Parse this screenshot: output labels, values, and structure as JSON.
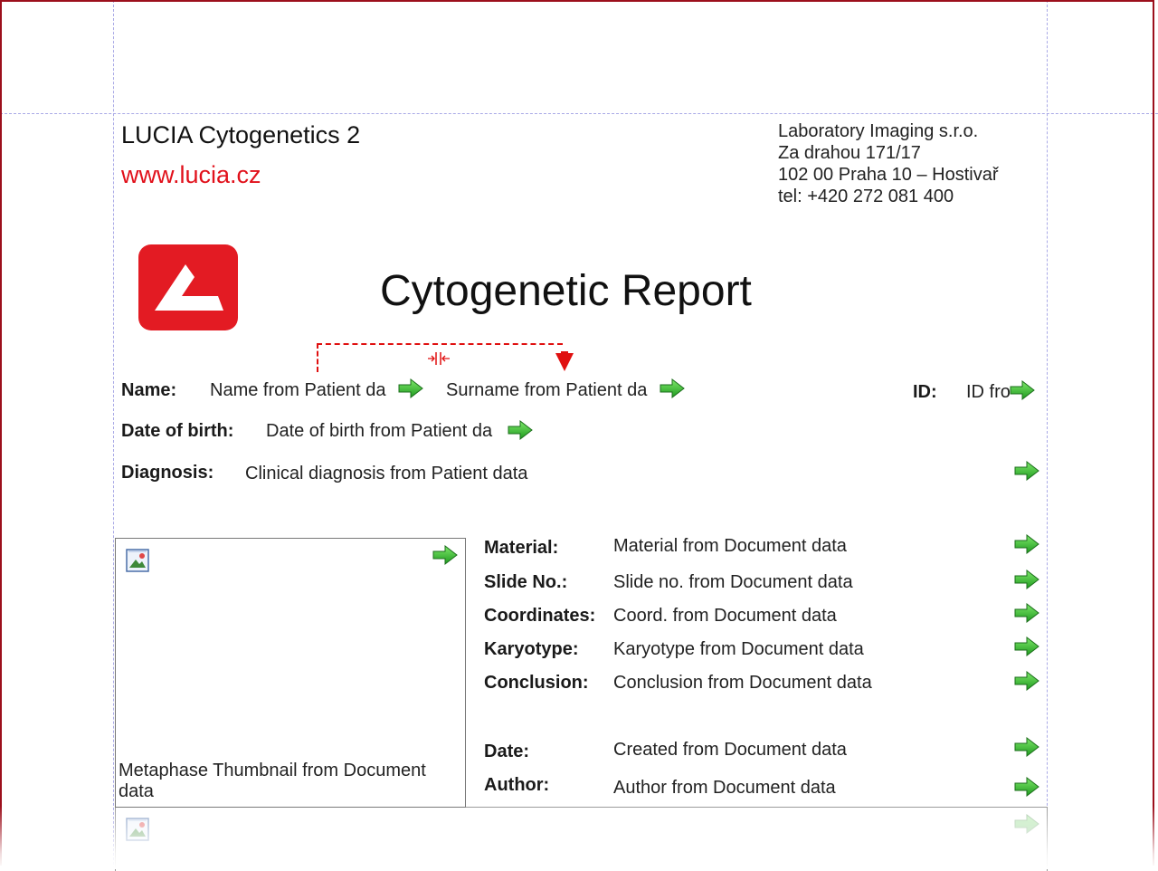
{
  "header": {
    "app_name": "LUCIA Cytogenetics 2",
    "website": "www.lucia.cz",
    "company_lines": [
      "Laboratory Imaging s.r.o.",
      "Za drahou 171/17",
      "102 00 Praha 10 – Hostivař",
      "tel: +420 272 081 400"
    ]
  },
  "logo": {
    "icon": "lucia-logo-icon",
    "color": "#e31b23"
  },
  "report_title": "Cytogenetic Report",
  "patient": {
    "name_label": "Name:",
    "name_value": "Name from Patient da",
    "surname_value": "Surname from Patient da",
    "id_label": "ID:",
    "id_value": "ID fro",
    "dob_label": "Date of birth:",
    "dob_value": "Date of birth from Patient da",
    "diagnosis_label": "Diagnosis:",
    "diagnosis_value": "Clinical diagnosis from Patient data"
  },
  "document": {
    "thumbnail_caption": "Metaphase Thumbnail from Document data",
    "fields": [
      {
        "label": "Material:",
        "value": "Material from Document data"
      },
      {
        "label": "Slide No.:",
        "value": "Slide no. from Document data"
      },
      {
        "label": "Coordinates:",
        "value": "Coord. from Document data"
      },
      {
        "label": "Karyotype:",
        "value": "Karyotype from Document data"
      },
      {
        "label": "Conclusion:",
        "value": "Conclusion from Document data"
      },
      {
        "label": "Date:",
        "value": "Created from Document data"
      },
      {
        "label": "Author:",
        "value": "Author from Document data"
      }
    ]
  },
  "icons": {
    "bind_arrow": "green-arrow-icon",
    "image_placeholder": "image-placeholder-icon",
    "link_pin": "red-pin-icon",
    "split_handle": "split-handle-icon"
  },
  "colors": {
    "accent_red": "#e1111b",
    "arrow_green": "#2fb52f",
    "guide_blue": "#a9a9e6",
    "frame": "#9c0f1c"
  }
}
